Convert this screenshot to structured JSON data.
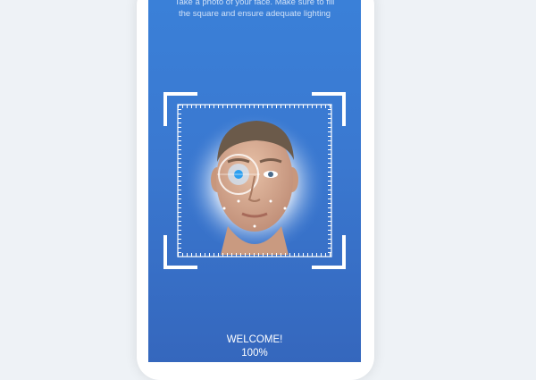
{
  "screen": {
    "instructions_line1": "Take a photo of your face. Make sure to fill",
    "instructions_line2": "the square and ensure adequate lighting",
    "welcome_label": "WELCOME!",
    "progress_label": "100%",
    "progress_value": 1.0
  },
  "colors": {
    "screen_top": "#3a80d8",
    "screen_bottom": "#3567bd",
    "frame": "#ffffff"
  },
  "icons": [
    "face-scan-frame-corner",
    "measurement-grid"
  ]
}
